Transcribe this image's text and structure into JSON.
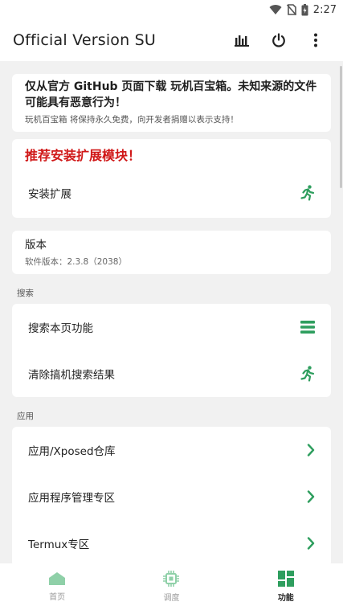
{
  "status_bar": {
    "time": "2:27"
  },
  "app_bar": {
    "title": "Official Version SU"
  },
  "notice": {
    "title": "仅从官方 GitHub 页面下载 玩机百宝箱。未知来源的文件可能具有恶意行为！",
    "subtitle": "玩机百宝箱 将保持永久免费，向开发者捐赠以表示支持！"
  },
  "recommend": {
    "heading": "推荐安装扩展模块！",
    "install_label": "安装扩展"
  },
  "version": {
    "title": "版本",
    "detail": "软件版本：2.3.8（2038）"
  },
  "search_section": {
    "header": "搜索",
    "items": [
      {
        "label": "搜索本页功能"
      },
      {
        "label": "清除搞机搜索结果"
      }
    ]
  },
  "apps_section": {
    "header": "应用",
    "items": [
      {
        "label": "应用/Xposed仓库"
      },
      {
        "label": "应用程序管理专区"
      },
      {
        "label": "Termux专区"
      }
    ]
  },
  "bottom_nav": {
    "items": [
      {
        "label": "首页"
      },
      {
        "label": "调度"
      },
      {
        "label": "功能"
      }
    ],
    "active_index": 2
  },
  "colors": {
    "accent": "#2e9e5e",
    "warning_red": "#d01818",
    "inactive_icon": "#8fd0a8"
  }
}
